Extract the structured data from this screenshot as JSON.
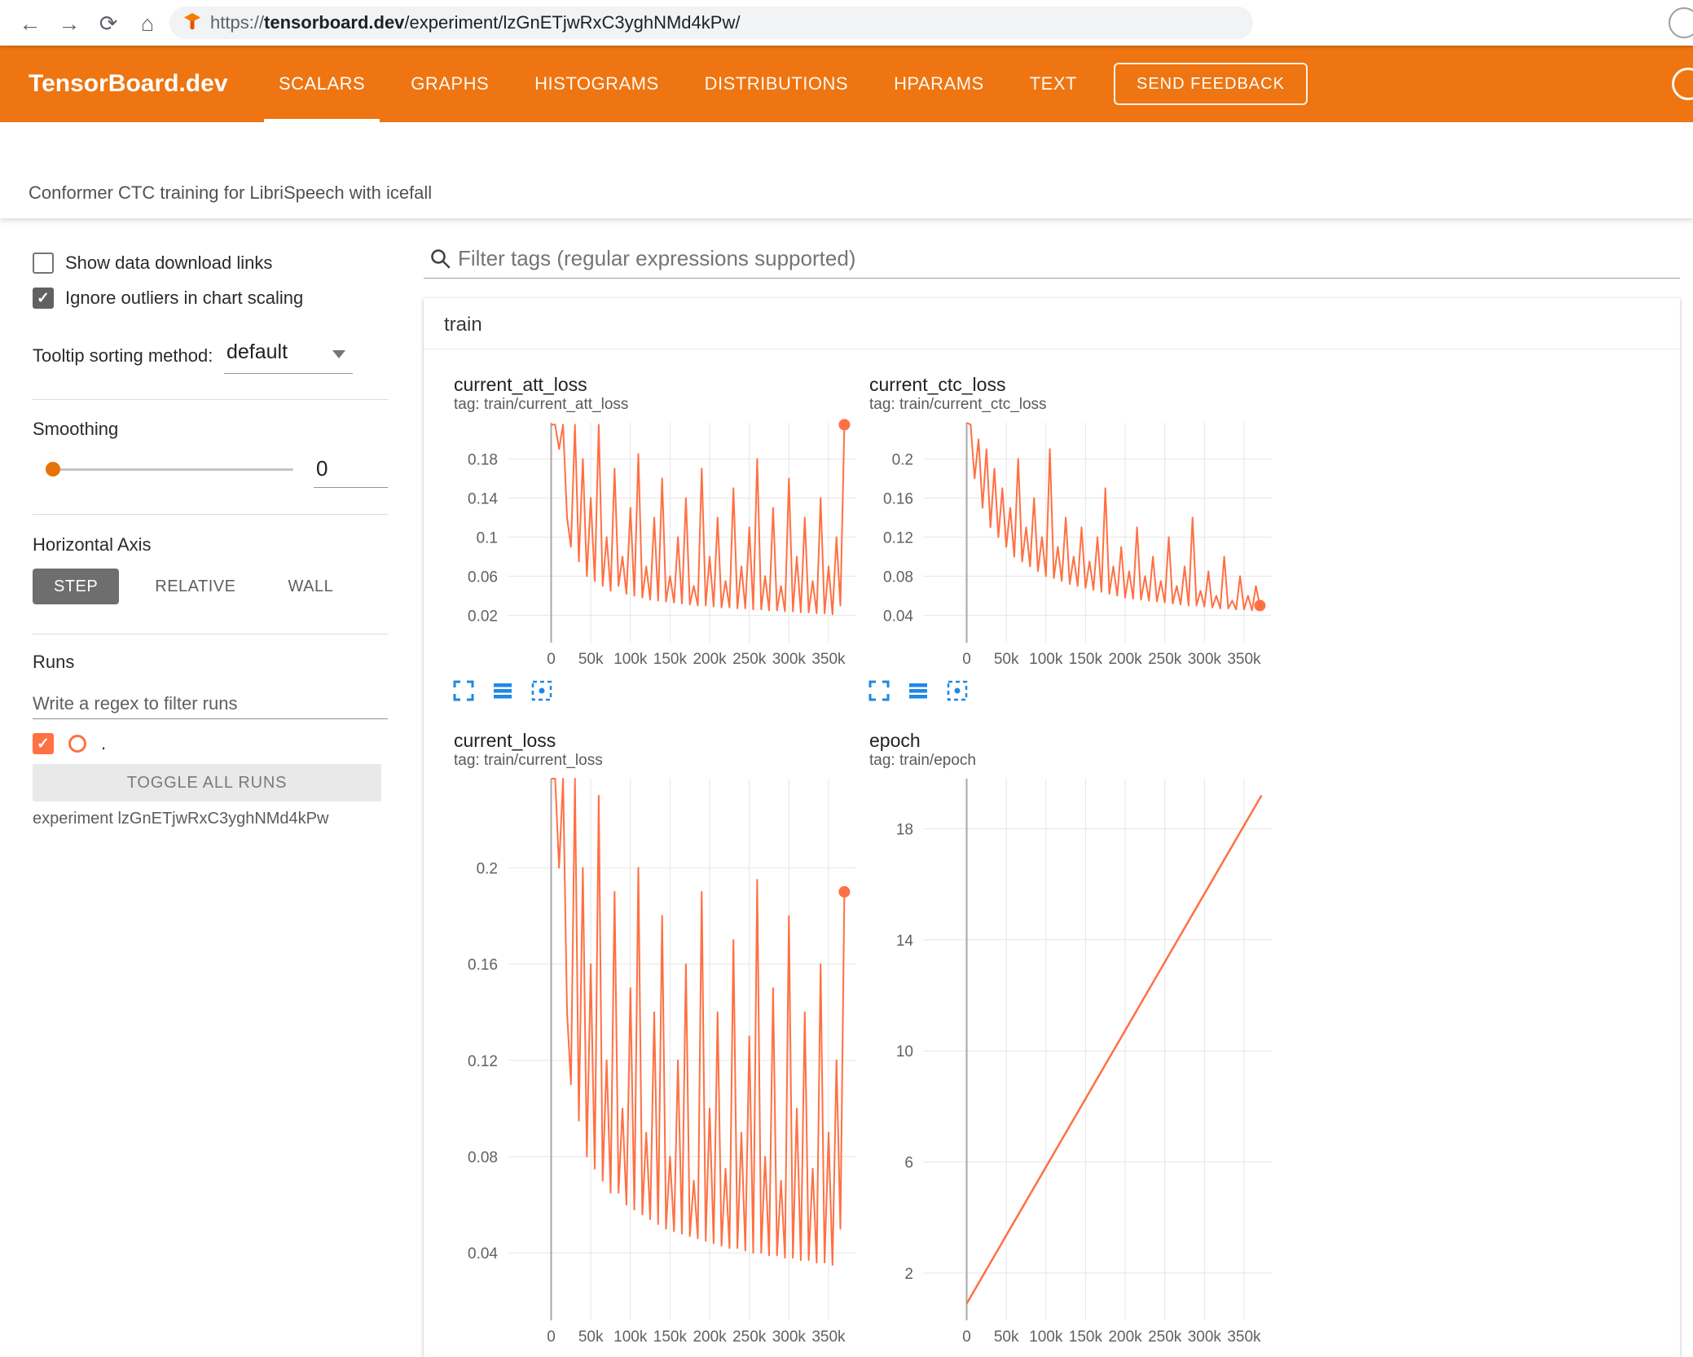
{
  "browser": {
    "url_scheme": "https://",
    "url_domain": "tensorboard.dev",
    "url_path": "/experiment/lzGnETjwRxC3yghNMd4kPw/"
  },
  "icons": {
    "back": "←",
    "forward": "→",
    "reload": "⟳",
    "home": "⌂",
    "check": "✓"
  },
  "header": {
    "logo": "TensorBoard.dev",
    "tabs": [
      {
        "label": "SCALARS",
        "active": true
      },
      {
        "label": "GRAPHS",
        "active": false
      },
      {
        "label": "HISTOGRAMS",
        "active": false
      },
      {
        "label": "DISTRIBUTIONS",
        "active": false
      },
      {
        "label": "HPARAMS",
        "active": false
      },
      {
        "label": "TEXT",
        "active": false
      }
    ],
    "feedback_button": "SEND FEEDBACK"
  },
  "experiment_title": "Conformer CTC training for LibriSpeech with icefall",
  "sidebar": {
    "show_data_download_links": {
      "label": "Show data download links",
      "checked": false
    },
    "ignore_outliers": {
      "label": "Ignore outliers in chart scaling",
      "checked": true
    },
    "tooltip_sorting": {
      "label": "Tooltip sorting method:",
      "value": "default"
    },
    "smoothing": {
      "label": "Smoothing",
      "value": "0"
    },
    "horizontal_axis": {
      "label": "Horizontal Axis",
      "options": [
        "STEP",
        "RELATIVE",
        "WALL"
      ],
      "selected": "STEP"
    },
    "runs": {
      "label": "Runs",
      "filter_placeholder": "Write a regex to filter runs",
      "run_name": ".",
      "run_checked": true,
      "toggle_button": "TOGGLE ALL RUNS",
      "experiment_caption": "experiment lzGnETjwRxC3yghNMd4kPw"
    }
  },
  "main": {
    "filter_placeholder": "Filter tags (regular expressions supported)",
    "section_title": "train"
  },
  "colors": {
    "header_orange": "#ee7511",
    "run_orange": "#ff7043",
    "icon_blue": "#1e88e5",
    "slider_orange": "#e8710a"
  },
  "chart_data": [
    {
      "type": "line",
      "title": "current_att_loss",
      "subtitle": "tag: train/current_att_loss",
      "color": "#ff7043",
      "end_marker": true,
      "xlim": [
        -55000,
        385000
      ],
      "ylim": [
        -0.008,
        0.217
      ],
      "x_ticks": [
        0,
        50000,
        100000,
        150000,
        200000,
        250000,
        300000,
        350000
      ],
      "x_tick_labels": [
        "0",
        "50k",
        "100k",
        "150k",
        "200k",
        "250k",
        "300k",
        "350k"
      ],
      "y_ticks": [
        0.02,
        0.06,
        0.1,
        0.14,
        0.18
      ],
      "y_tick_labels": [
        "0.02",
        "0.06",
        "0.1",
        "0.14",
        "0.18"
      ],
      "x_start": 0,
      "x_step": 5000,
      "values": [
        0.215,
        0.215,
        0.19,
        0.215,
        0.12,
        0.09,
        0.215,
        0.075,
        0.18,
        0.06,
        0.14,
        0.055,
        0.215,
        0.05,
        0.1,
        0.045,
        0.17,
        0.05,
        0.08,
        0.042,
        0.13,
        0.04,
        0.185,
        0.038,
        0.07,
        0.036,
        0.12,
        0.035,
        0.16,
        0.034,
        0.06,
        0.033,
        0.1,
        0.032,
        0.14,
        0.031,
        0.05,
        0.03,
        0.17,
        0.03,
        0.08,
        0.029,
        0.12,
        0.028,
        0.055,
        0.028,
        0.15,
        0.027,
        0.07,
        0.027,
        0.11,
        0.026,
        0.18,
        0.026,
        0.06,
        0.025,
        0.13,
        0.025,
        0.05,
        0.024,
        0.16,
        0.024,
        0.08,
        0.023,
        0.12,
        0.023,
        0.055,
        0.022,
        0.14,
        0.022,
        0.07,
        0.021,
        0.1,
        0.03,
        0.215
      ]
    },
    {
      "type": "line",
      "title": "current_ctc_loss",
      "subtitle": "tag: train/current_ctc_loss",
      "color": "#ff7043",
      "end_marker": true,
      "xlim": [
        -55000,
        385000
      ],
      "ylim": [
        0.012,
        0.237
      ],
      "x_ticks": [
        0,
        50000,
        100000,
        150000,
        200000,
        250000,
        300000,
        350000
      ],
      "x_tick_labels": [
        "0",
        "50k",
        "100k",
        "150k",
        "200k",
        "250k",
        "300k",
        "350k"
      ],
      "y_ticks": [
        0.04,
        0.08,
        0.12,
        0.16,
        0.2
      ],
      "y_tick_labels": [
        "0.04",
        "0.08",
        "0.12",
        "0.16",
        "0.2"
      ],
      "x_start": 0,
      "x_step": 5000,
      "values": [
        0.24,
        0.235,
        0.18,
        0.22,
        0.15,
        0.21,
        0.13,
        0.19,
        0.12,
        0.17,
        0.11,
        0.15,
        0.1,
        0.2,
        0.095,
        0.13,
        0.09,
        0.16,
        0.085,
        0.12,
        0.08,
        0.21,
        0.078,
        0.11,
        0.075,
        0.14,
        0.072,
        0.1,
        0.07,
        0.13,
        0.068,
        0.095,
        0.066,
        0.12,
        0.064,
        0.17,
        0.062,
        0.09,
        0.06,
        0.11,
        0.058,
        0.085,
        0.057,
        0.13,
        0.056,
        0.08,
        0.055,
        0.1,
        0.054,
        0.075,
        0.053,
        0.12,
        0.052,
        0.07,
        0.051,
        0.09,
        0.05,
        0.14,
        0.05,
        0.065,
        0.049,
        0.085,
        0.048,
        0.06,
        0.047,
        0.1,
        0.047,
        0.055,
        0.046,
        0.08,
        0.046,
        0.06,
        0.045,
        0.07,
        0.05
      ]
    },
    {
      "type": "line",
      "title": "current_loss",
      "subtitle": "tag: train/current_loss",
      "color": "#ff7043",
      "end_marker": true,
      "xlim": [
        -55000,
        385000
      ],
      "ylim": [
        0.012,
        0.237
      ],
      "x_ticks": [
        0,
        50000,
        100000,
        150000,
        200000,
        250000,
        300000,
        350000
      ],
      "x_tick_labels": [
        "0",
        "50k",
        "100k",
        "150k",
        "200k",
        "250k",
        "300k",
        "350k"
      ],
      "y_ticks": [
        0.04,
        0.08,
        0.12,
        0.16,
        0.2
      ],
      "y_tick_labels": [
        "0.04",
        "0.08",
        "0.12",
        "0.16",
        "0.2"
      ],
      "x_start": 0,
      "x_step": 5000,
      "values": [
        0.245,
        0.245,
        0.2,
        0.245,
        0.14,
        0.11,
        0.245,
        0.095,
        0.2,
        0.08,
        0.16,
        0.075,
        0.23,
        0.07,
        0.12,
        0.065,
        0.19,
        0.065,
        0.1,
        0.06,
        0.15,
        0.058,
        0.2,
        0.056,
        0.09,
        0.054,
        0.14,
        0.052,
        0.18,
        0.05,
        0.08,
        0.049,
        0.12,
        0.048,
        0.16,
        0.047,
        0.07,
        0.046,
        0.19,
        0.045,
        0.1,
        0.044,
        0.14,
        0.043,
        0.075,
        0.042,
        0.17,
        0.042,
        0.09,
        0.041,
        0.13,
        0.04,
        0.195,
        0.04,
        0.08,
        0.039,
        0.15,
        0.039,
        0.07,
        0.038,
        0.18,
        0.038,
        0.1,
        0.037,
        0.14,
        0.037,
        0.075,
        0.036,
        0.16,
        0.036,
        0.09,
        0.035,
        0.12,
        0.05,
        0.19
      ]
    },
    {
      "type": "line",
      "title": "epoch",
      "subtitle": "tag: train/epoch",
      "color": "#ff7043",
      "end_marker": false,
      "stroke_width": 2.5,
      "xlim": [
        -55000,
        385000
      ],
      "ylim": [
        0.3,
        19.8
      ],
      "x_ticks": [
        0,
        50000,
        100000,
        150000,
        200000,
        250000,
        300000,
        350000
      ],
      "x_tick_labels": [
        "0",
        "50k",
        "100k",
        "150k",
        "200k",
        "250k",
        "300k",
        "350k"
      ],
      "y_ticks": [
        2,
        6,
        10,
        14,
        18
      ],
      "y_tick_labels": [
        "2",
        "6",
        "10",
        "14",
        "18"
      ],
      "x_start": 0,
      "x_step": 372000,
      "values": [
        0.9,
        19.2
      ]
    }
  ]
}
